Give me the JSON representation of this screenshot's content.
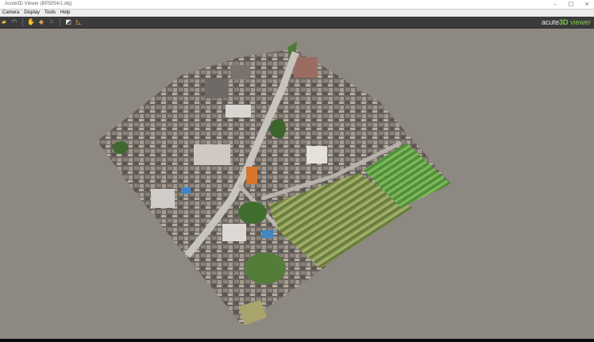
{
  "window": {
    "title": "Acute3D Viewer (BP5054/1.obj)"
  },
  "menu": {
    "items": [
      "Camera",
      "Display",
      "Tools",
      "Help"
    ]
  },
  "toolbar": {
    "tools": [
      {
        "icon": "open-folder-icon",
        "glyph": "▰",
        "color": "#f2c230"
      },
      {
        "icon": "rotate-orbit-icon",
        "glyph": "◠",
        "color": "#9ac6ee"
      },
      {
        "icon": "pan-hand-icon",
        "glyph": "✋",
        "color": "#e8c08a"
      },
      {
        "icon": "walk-camera-icon",
        "glyph": "◆",
        "color": "#d7a24a"
      },
      {
        "icon": "grid-points-icon",
        "glyph": "⁙",
        "color": "#cfd7e0"
      },
      {
        "icon": "measure-ruler-icon",
        "glyph": "◩",
        "color": "#e7e7e7"
      },
      {
        "icon": "triangle-set-square-icon",
        "glyph": "◺",
        "color": "#f0c14a"
      }
    ],
    "brand": {
      "prefix": "acute",
      "accent": "3D",
      "suffix": " viewer",
      "accent_color": "#7ec84a"
    }
  },
  "viewport": {
    "background": "#8d8882",
    "model": "3D reality mesh of a dense village and farmland plots"
  }
}
